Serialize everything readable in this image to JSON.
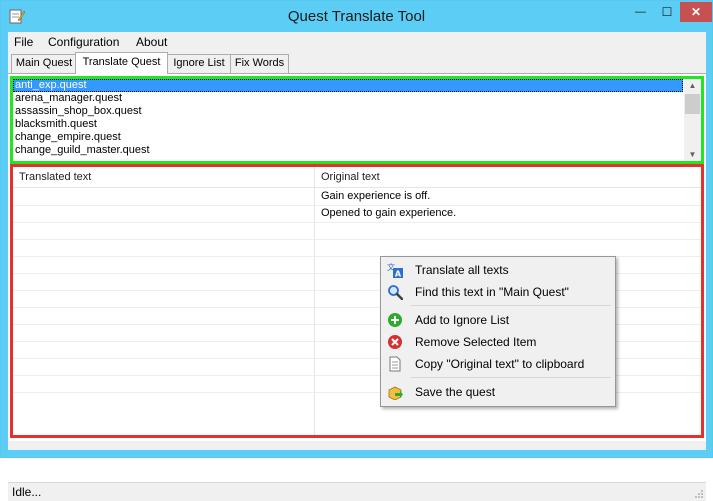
{
  "window": {
    "title": "Quest Translate Tool",
    "buttons": {
      "minimize": "—",
      "maximize": "☐",
      "close": "✕"
    },
    "accent_color": "#5ccdf5",
    "close_color": "#c75050"
  },
  "menubar": [
    "File",
    "Configuration",
    "About"
  ],
  "tabs": [
    {
      "label": "Main Quest",
      "active": false
    },
    {
      "label": "Translate Quest",
      "active": true
    },
    {
      "label": "Ignore List",
      "active": false
    },
    {
      "label": "Fix Words",
      "active": false
    }
  ],
  "quest_list": {
    "items": [
      "anti_exp.quest",
      "arena_manager.quest",
      "assassin_shop_box.quest",
      "blacksmith.quest",
      "change_empire.quest",
      "change_guild_master.quest"
    ],
    "selected_index": 0,
    "frame_color": "#22e622"
  },
  "grid": {
    "frame_color": "#e63030",
    "columns": [
      "Translated text",
      "Original text"
    ],
    "rows": [
      {
        "translated": "",
        "original": "Gain experience is off."
      },
      {
        "translated": "",
        "original": "Opened to gain experience."
      }
    ],
    "empty_rows": 10
  },
  "context_menu": {
    "items": [
      {
        "label": "Translate all texts",
        "icon": "translate-icon"
      },
      {
        "label": "Find this text in \"Main Quest\"",
        "icon": "magnifier-icon"
      },
      {
        "label": "Add to Ignore List",
        "icon": "add-green-icon"
      },
      {
        "label": "Remove Selected Item",
        "icon": "remove-red-icon"
      },
      {
        "label": "Copy \"Original text\" to clipboard",
        "icon": "document-icon"
      },
      {
        "label": "Save the quest",
        "icon": "save-box-icon"
      }
    ]
  },
  "status": {
    "text": "Idle..."
  }
}
